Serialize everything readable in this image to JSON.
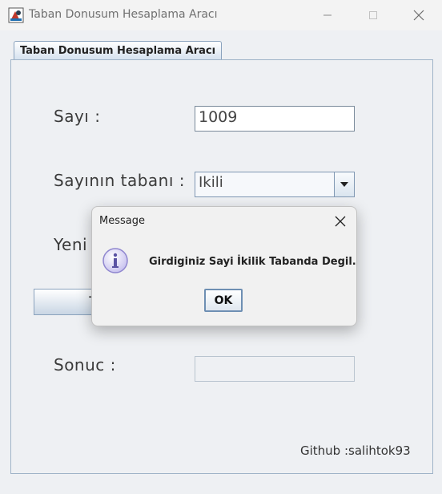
{
  "window": {
    "title": "Taban Donusum Hesaplama Aracı"
  },
  "tab": {
    "label": "Taban Donusum Hesaplama Aracı"
  },
  "form": {
    "number_label": "Sayı :",
    "number_value": "1009",
    "base_label": "Sayının tabanı :",
    "base_value": "Ikili",
    "new_base_label": "Yeni",
    "convert_label": "T",
    "result_label": "Sonuc :",
    "result_value": ""
  },
  "footer": {
    "github": "Github :salihtok93"
  },
  "dialog": {
    "title": "Message",
    "message": "Girdiginiz Sayi İkilik Tabanda Degil.",
    "ok_label": "OK"
  },
  "colors": {
    "accent": "#6e8fb3",
    "info_icon": "#8f86cf"
  }
}
